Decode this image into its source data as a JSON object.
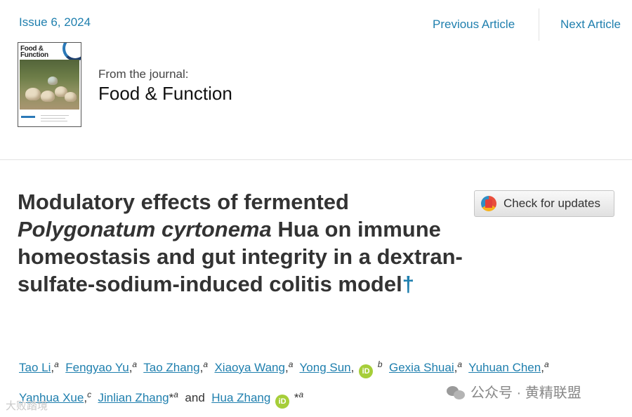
{
  "header": {
    "issue": "Issue 6, 2024",
    "prev_label": "Previous Article",
    "next_label": "Next Article"
  },
  "journal": {
    "cover_title_line1": "Food &",
    "cover_title_line2": "Function",
    "from_label": "From the journal:",
    "name": "Food & Function"
  },
  "article": {
    "title_part1": "Modulatory effects of fermented ",
    "title_italic": "Polygonatum cyrtonema",
    "title_part2": " Hua on immune homeostasis and gut integrity in a dextran-sulfate-sodium-induced colitis model",
    "title_dagger": "†",
    "check_updates_label": "Check for updates"
  },
  "authors": [
    {
      "name": "Tao Li",
      "sep": ",",
      "aff": "a"
    },
    {
      "name": "Fengyao Yu",
      "sep": ",",
      "aff": "a"
    },
    {
      "name": "Tao Zhang",
      "sep": ",",
      "aff": "a"
    },
    {
      "name": "Xiaoya Wang",
      "sep": ",",
      "aff": "a"
    },
    {
      "name": "Yong Sun",
      "sep": ",",
      "aff": "b"
    },
    {
      "name": "Gexia Shuai",
      "sep": ",",
      "aff": "a"
    },
    {
      "name": "Yuhuan Chen",
      "sep": ",",
      "aff": "a"
    },
    {
      "name": "Yanhua Xue",
      "sep": ",",
      "aff": "c"
    },
    {
      "name": "Jinlian Zhang",
      "sep": "*",
      "aff": "a"
    },
    {
      "name": "Hua Zhang",
      "sep": "*",
      "aff": "a"
    }
  ],
  "and_word": "and",
  "orcid_label": "iD",
  "watermark": {
    "text": "公众号 · 黄精联盟",
    "text2": "大败踏境"
  },
  "colors": {
    "link": "#1f7fae",
    "orcid": "#a6ce39",
    "title": "#333333"
  }
}
